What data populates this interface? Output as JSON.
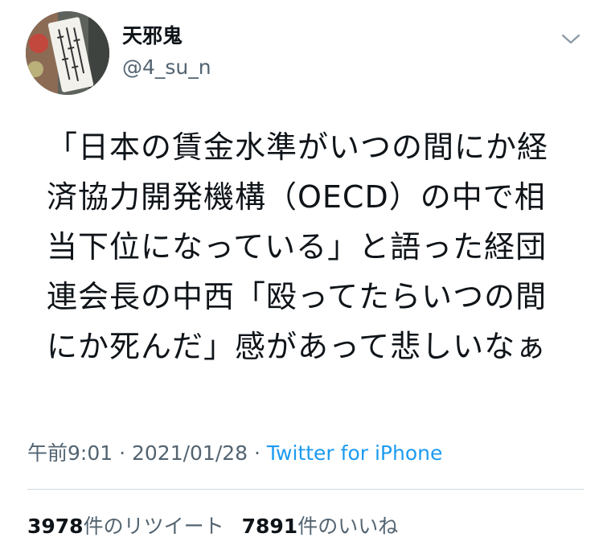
{
  "author": {
    "display_name": "天邪鬼",
    "handle": "@4_su_n"
  },
  "tweet": {
    "lines": [
      "「日本の賃金水準がいつの間にか経",
      "済協力開発機構（OECD）の中で相",
      "当下位になっている」と語った経団",
      "連会長の中西「殴ってたらいつの間",
      "にか死んだ」感があって悲しいなぁ"
    ]
  },
  "meta": {
    "time": "午前9:01",
    "sep1": " · ",
    "date": "2021/01/28",
    "sep2": " · ",
    "source": "Twitter for iPhone"
  },
  "stats": {
    "retweets_count": "3978",
    "retweets_label": "件のリツイート",
    "likes_count": "7891",
    "likes_label": "件のいいね"
  },
  "icons": {
    "menu": "chevron-down-icon",
    "avatar": "avatar-photo"
  },
  "colors": {
    "text": "#0f1419",
    "secondary": "#536471",
    "link": "#1d9bf0",
    "divider": "#cfd9de"
  }
}
